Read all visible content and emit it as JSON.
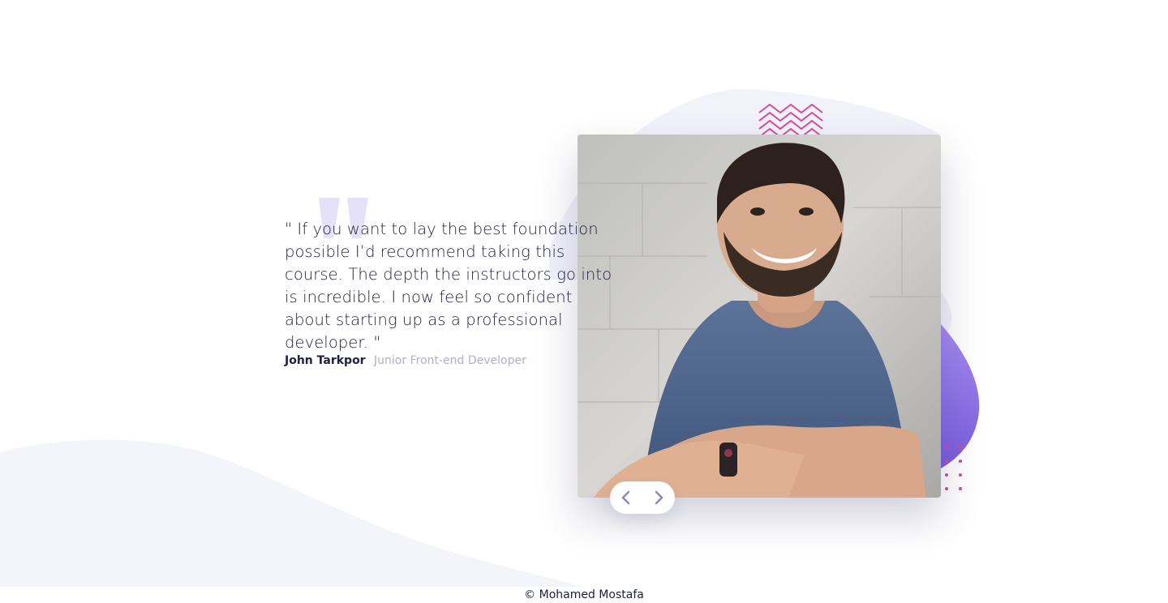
{
  "testimonial": {
    "quote": "\" If you want to lay the best foundation possible I’d recommend taking this course. The depth the instructors go into is incredible. I now feel so confident about starting up as a professional developer. \"",
    "author_name": "John Tarkpor",
    "author_role": "Junior Front-end Developer"
  },
  "navigation": {
    "previous_icon": "chevron-left-icon",
    "next_icon": "chevron-right-icon"
  },
  "footer": {
    "credit": "© Mohamed Mostafa"
  },
  "decorations": {
    "quote_icon": "quote-mark-icon",
    "zigzag_icon": "zigzag-pattern-icon",
    "dots_icon": "dot-grid-icon"
  },
  "colors": {
    "text_dark": "#202040",
    "text_muted": "#b0aec9",
    "accent_purple": "#8a6fe0",
    "accent_pink": "#d9499a",
    "background_wave": "#f4f4fb"
  }
}
